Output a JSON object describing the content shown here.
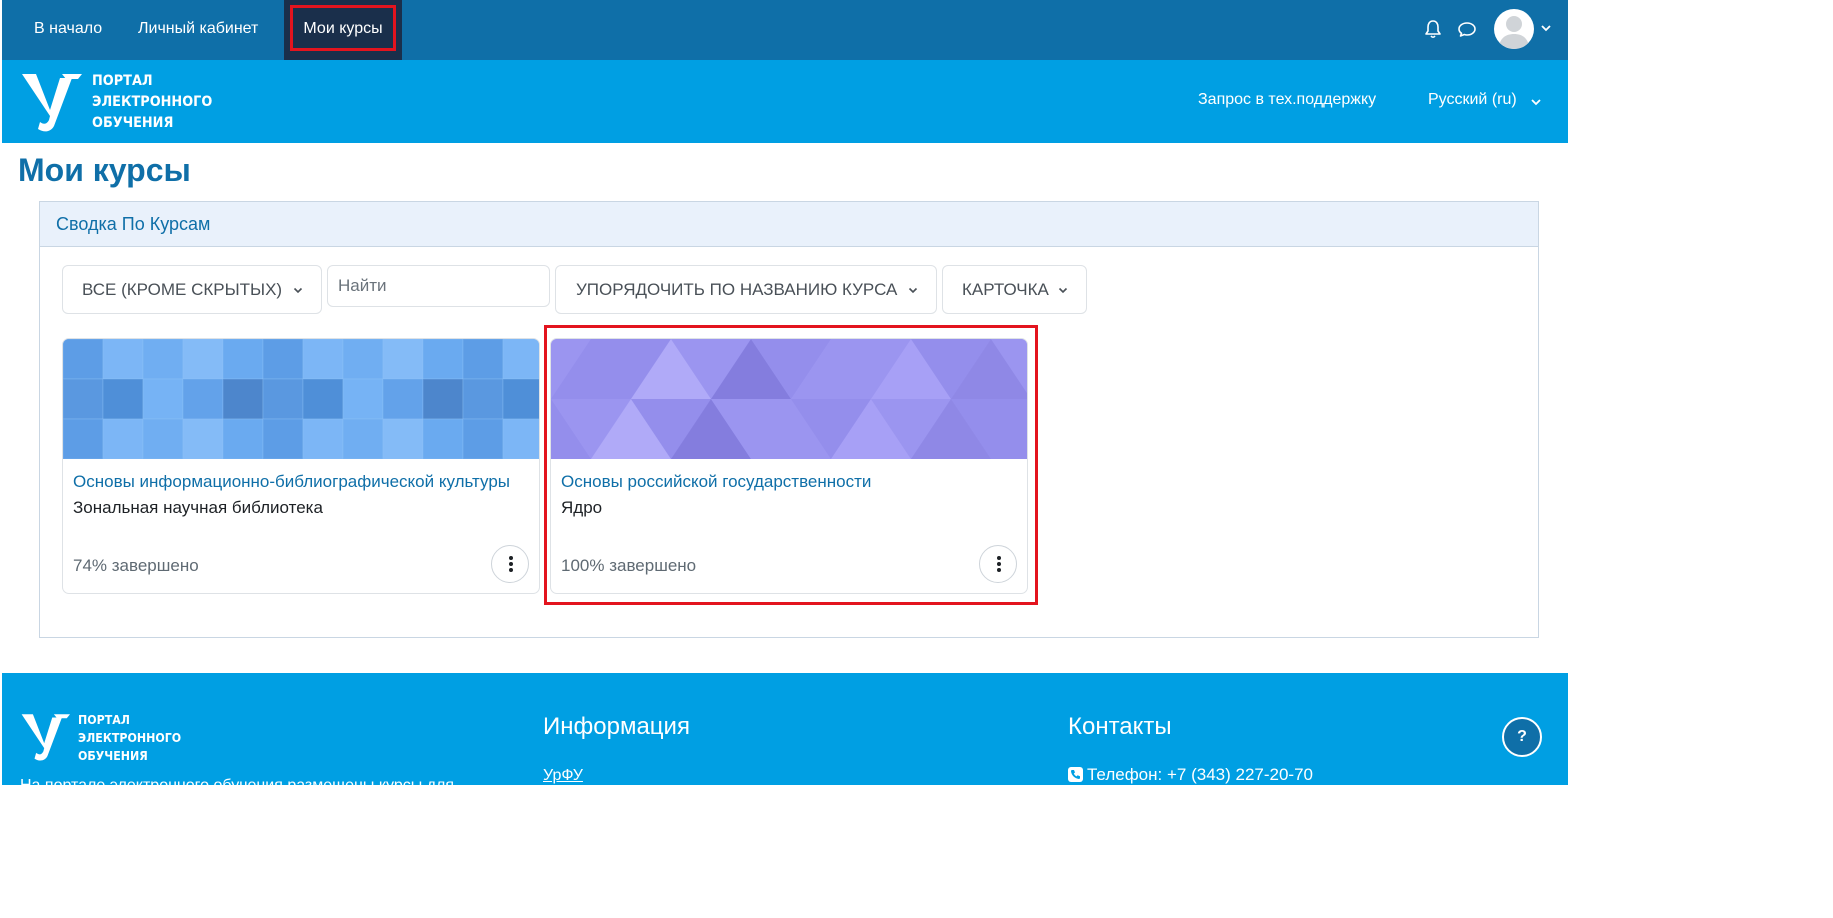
{
  "topnav": {
    "items": [
      {
        "label": "В начало"
      },
      {
        "label": "Личный кабинет"
      },
      {
        "label": "Мои курсы",
        "active": true
      }
    ],
    "icons": [
      "bell-icon",
      "chat-icon",
      "user-avatar",
      "chevron-down-icon"
    ]
  },
  "brand": {
    "logo_lines": [
      "ПОРТАЛ",
      "ЭЛЕКТРОННОГО",
      "ОБУЧЕНИЯ"
    ],
    "support_label": "Запрос в тех.поддержку",
    "language_label": "Русский (ru)"
  },
  "page": {
    "title": "Мои курсы"
  },
  "block": {
    "title": "Сводка По Курсам",
    "filter_label": "ВСЕ (КРОМЕ СКРЫТЫХ)",
    "search_placeholder": "Найти",
    "sort_label": "УПОРЯДОЧИТЬ ПО НАЗВАНИЮ КУРСА",
    "view_label": "КАРТОЧКА",
    "courses": [
      {
        "name": "Основы информационно-библиографической культуры",
        "category": "Зональная научная библиотека",
        "progress_text": "74% завершено",
        "progress": 74,
        "image_color": "#6aaaf0"
      },
      {
        "name": "Основы российской государственности",
        "category": "Ядро",
        "progress_text": "100% завершено",
        "progress": 100,
        "image_color": "#9b95f0"
      }
    ]
  },
  "footer": {
    "logo_lines": [
      "ПОРТАЛ",
      "ЭЛЕКТРОННОГО",
      "ОБУЧЕНИЯ"
    ],
    "info_heading": "Информация",
    "info_link": "УрФУ",
    "contacts_heading": "Контакты",
    "phone": "Телефон: +7 (343) 227-20-70",
    "description": "На портале электронного обучения размещены курсы для",
    "help_label": "?"
  },
  "colors": {
    "topnav": "#0f6fa8",
    "brandbar": "#009fe3",
    "active_nav": "#1a2f4b",
    "highlight": "#e3141e",
    "link": "#0f6fa8"
  }
}
